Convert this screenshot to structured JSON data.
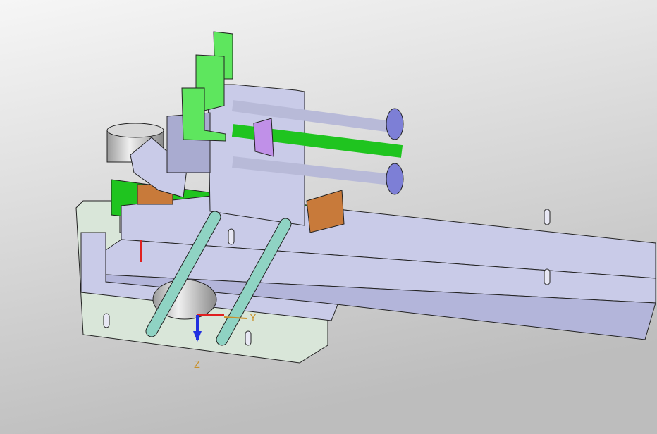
{
  "viewport": {
    "background_top": "#f6f6f6",
    "background_bottom": "#bdbdbd"
  },
  "model": {
    "colors": {
      "base_plate": "#d9e6d9",
      "rail": "#c9cbe8",
      "rail_dark": "#a9abd0",
      "belt": "#1fc41f",
      "bracket": "#5ee65e",
      "guide_rod": "#8fd3c3",
      "knob": "#7d7fd6",
      "block": "#c87a3a",
      "purple_part": "#c090e8"
    }
  },
  "triad": {
    "y_label": "Y",
    "z_label": "Z",
    "x_color": "#e02020",
    "y_color": "#c8902a",
    "z_color": "#2030e0"
  }
}
